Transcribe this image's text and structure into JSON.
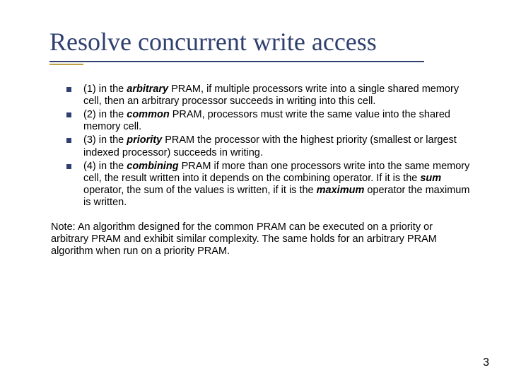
{
  "title": "Resolve concurrent write access",
  "bullets": [
    {
      "pre": "(1) in the ",
      "em": "arbitrary",
      "post": " PRAM, if multiple processors write into a single shared memory cell, then an arbitrary processor succeeds in writing into this cell."
    },
    {
      "pre": "(2) in the ",
      "em": "common",
      "post": " PRAM, processors must write the same value into the shared memory cell."
    },
    {
      "pre": "(3) in the ",
      "em": "priority",
      "post": " PRAM the processor with the highest priority (smallest or largest indexed processor) succeeds in writing."
    },
    {
      "pre": "(4) in the ",
      "em": "combining",
      "post1": " PRAM if more than one processors write into the same memory cell, the result written into it depends on the combining operator. If it is the ",
      "em2": "sum",
      "post2": " operator, the sum of the values is written, if it is the ",
      "em3": "maximum",
      "post3": " operator the maximum is written."
    }
  ],
  "note": "Note: An algorithm designed for the common PRAM can be executed on a priority or arbitrary PRAM and exhibit similar complexity. The same holds for an arbitrary PRAM algorithm when run on a priority PRAM.",
  "page_number": "3"
}
